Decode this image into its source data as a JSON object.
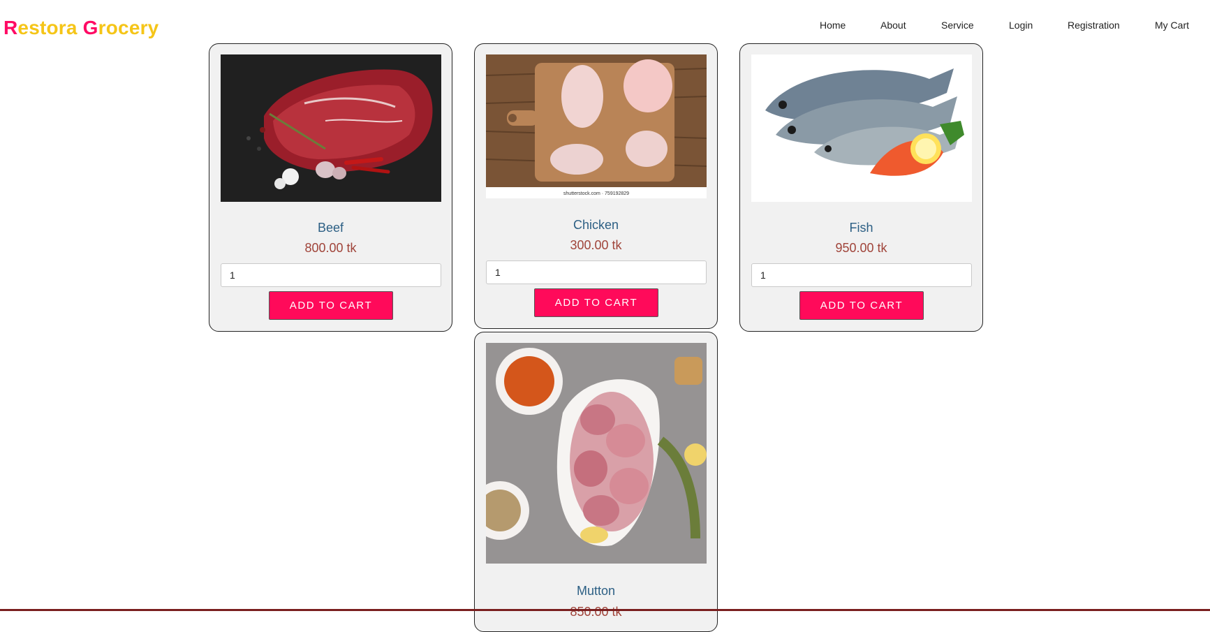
{
  "brand": {
    "letter1": "R",
    "word1_rest": "estora",
    "letter2": "G",
    "word2_rest": "rocery"
  },
  "nav": [
    {
      "label": "Home"
    },
    {
      "label": "About"
    },
    {
      "label": "Service"
    },
    {
      "label": "Login"
    },
    {
      "label": "Registration"
    },
    {
      "label": "My Cart"
    }
  ],
  "products": [
    {
      "name": "Beef",
      "price": "800.00 tk",
      "qty": "1",
      "button": "ADD TO CART",
      "image": "beef-photo"
    },
    {
      "name": "Chicken",
      "price": "300.00 tk",
      "qty": "1",
      "button": "ADD TO CART",
      "image": "chicken-photo",
      "image_caption": "shutterstock.com · 759192829"
    },
    {
      "name": "Fish",
      "price": "950.00 tk",
      "qty": "1",
      "button": "ADD TO CART",
      "image": "fish-photo"
    },
    {
      "name": "Mutton",
      "price": "850.00 tk",
      "image": "mutton-photo"
    }
  ],
  "colors": {
    "brand_yellow": "#f5c518",
    "brand_pink": "#ff0a64",
    "button": "#ff0a5a",
    "product_name": "#2c5f84",
    "price": "#a0443a"
  }
}
